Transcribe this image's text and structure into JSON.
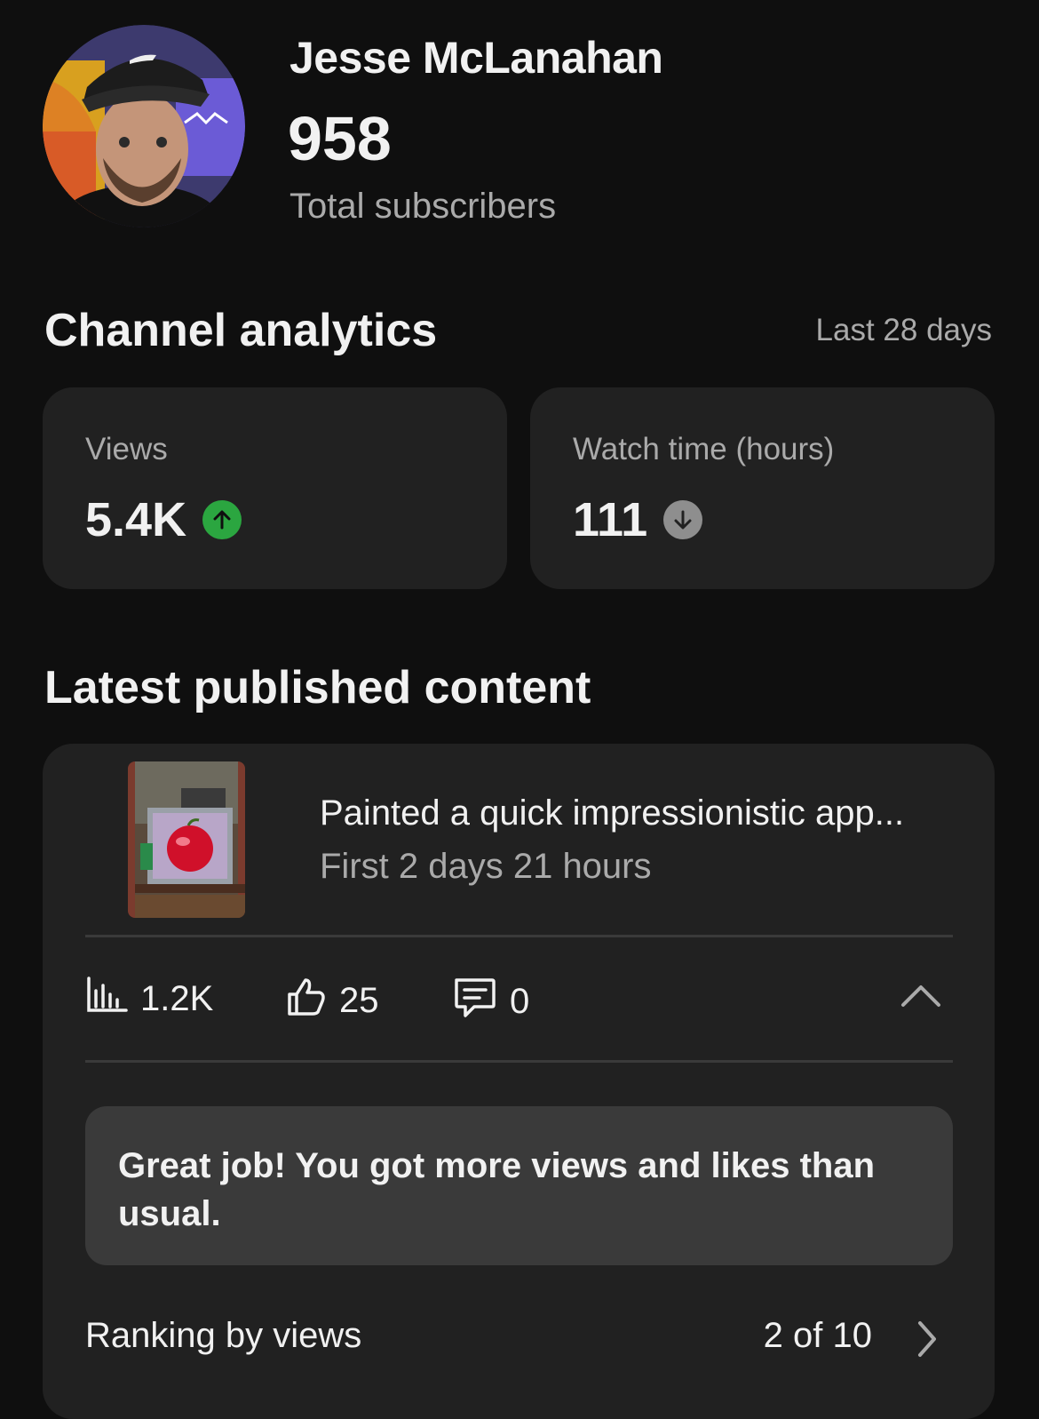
{
  "header": {
    "channel_name": "Jesse McLanahan",
    "subscriber_count": "958",
    "subscriber_label": "Total subscribers",
    "avatar_icon": "person-avatar"
  },
  "analytics": {
    "title": "Channel analytics",
    "range": "Last 28 days",
    "metrics": [
      {
        "label": "Views",
        "value": "5.4K",
        "trend": "up",
        "trend_color": "#2ba640",
        "icon": "arrow-up-icon"
      },
      {
        "label": "Watch time (hours)",
        "value": "111",
        "trend": "down",
        "trend_color": "#8e8e8e",
        "icon": "arrow-down-icon"
      }
    ]
  },
  "latest": {
    "title": "Latest published content",
    "video": {
      "title": "Painted a quick impressionistic app...",
      "period": "First 2 days 21 hours",
      "thumbnail_icon": "video-thumbnail"
    },
    "stats": {
      "views": "1.2K",
      "likes": "25",
      "comments": "0"
    },
    "insight": "Great job! You got more views and likes than usual.",
    "ranking_label": "Ranking by views",
    "ranking_value": "2 of 10"
  }
}
